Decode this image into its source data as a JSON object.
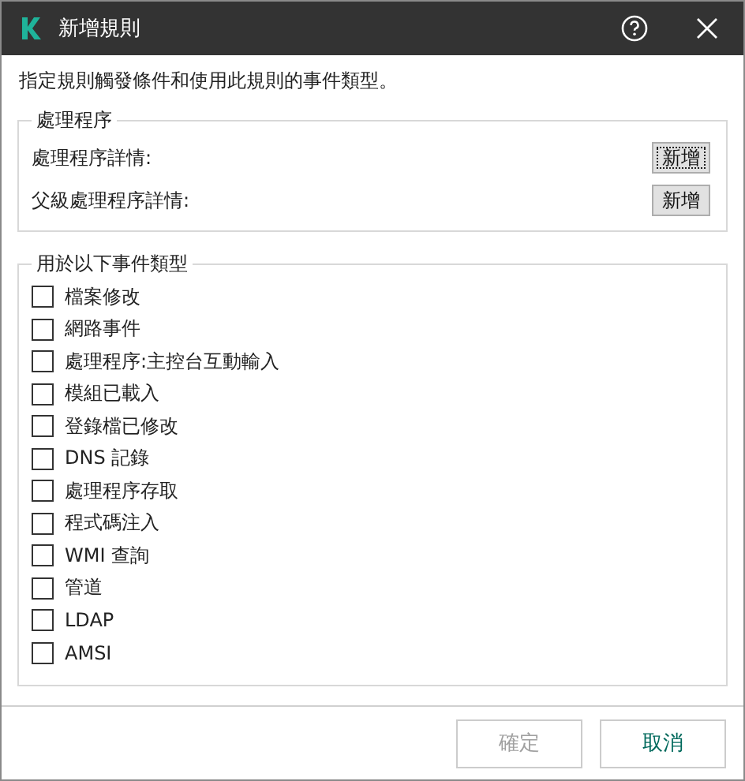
{
  "window": {
    "title": "新增規則"
  },
  "intro": "指定規則觸發條件和使用此規則的事件類型。",
  "process_group": {
    "legend": "處理程序",
    "rows": [
      {
        "label": "處理程序詳情:",
        "button": "新增",
        "focused": true
      },
      {
        "label": "父級處理程序詳情:",
        "button": "新增",
        "focused": false
      }
    ]
  },
  "event_group": {
    "legend": "用於以下事件類型",
    "items": [
      {
        "label": "檔案修改",
        "checked": false
      },
      {
        "label": "網路事件",
        "checked": false
      },
      {
        "label": "處理程序:主控台互動輸入",
        "checked": false
      },
      {
        "label": "模組已載入",
        "checked": false
      },
      {
        "label": "登錄檔已修改",
        "checked": false
      },
      {
        "label": "DNS 記錄",
        "checked": false
      },
      {
        "label": "處理程序存取",
        "checked": false
      },
      {
        "label": "程式碼注入",
        "checked": false
      },
      {
        "label": "WMI 查詢",
        "checked": false
      },
      {
        "label": "管道",
        "checked": false
      },
      {
        "label": "LDAP",
        "checked": false
      },
      {
        "label": "AMSI",
        "checked": false
      }
    ]
  },
  "footer": {
    "buttons": [
      {
        "label": "確定",
        "disabled": true
      },
      {
        "label": "取消",
        "disabled": false
      }
    ]
  }
}
